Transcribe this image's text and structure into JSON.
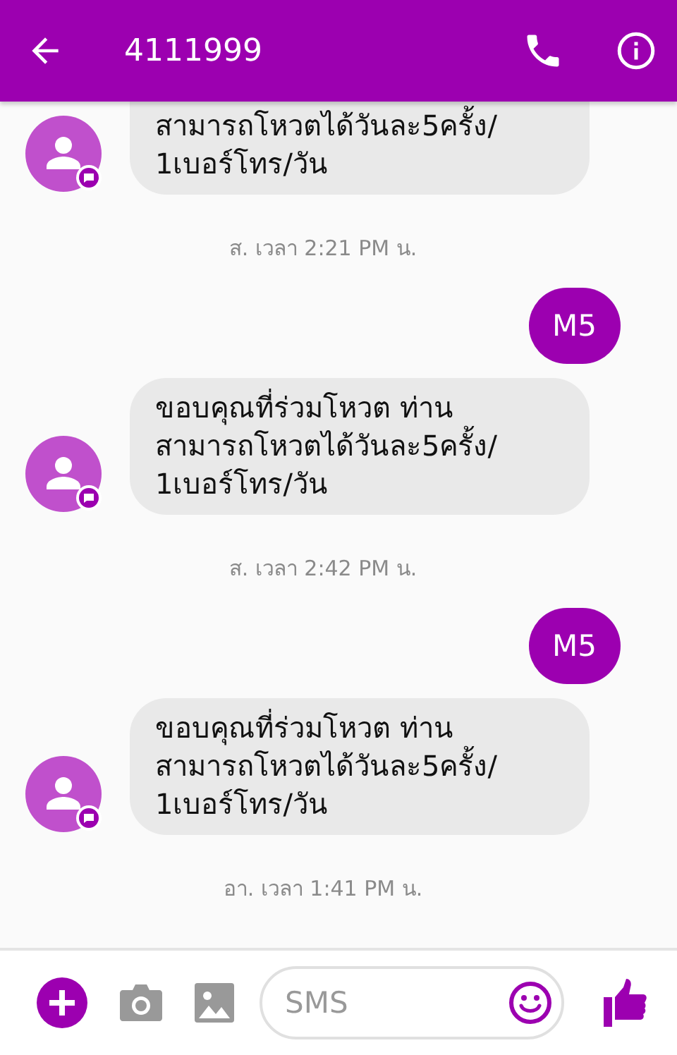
{
  "header": {
    "title": "4111999"
  },
  "messages": [
    {
      "kind": "incoming",
      "text": "สามารถโหวตได้วันละ5ครั้ง/\n1เบอร์โทร/วัน"
    },
    {
      "kind": "timestamp",
      "text": "ส. เวลา 2:21 PM น."
    },
    {
      "kind": "outgoing",
      "text": "M5"
    },
    {
      "kind": "incoming",
      "text": "ขอบคุณที่ร่วมโหวต ท่าน\nสามารถโหวตได้วันละ5ครั้ง/\n1เบอร์โทร/วัน"
    },
    {
      "kind": "timestamp",
      "text": "ส. เวลา 2:42 PM น."
    },
    {
      "kind": "outgoing",
      "text": "M5"
    },
    {
      "kind": "incoming",
      "text": "ขอบคุณที่ร่วมโหวต ท่าน\nสามารถโหวตได้วันละ5ครั้ง/\n1เบอร์โทร/วัน"
    },
    {
      "kind": "timestamp",
      "text": "อา. เวลา 1:41 PM น."
    }
  ],
  "composer": {
    "placeholder": "SMS"
  }
}
